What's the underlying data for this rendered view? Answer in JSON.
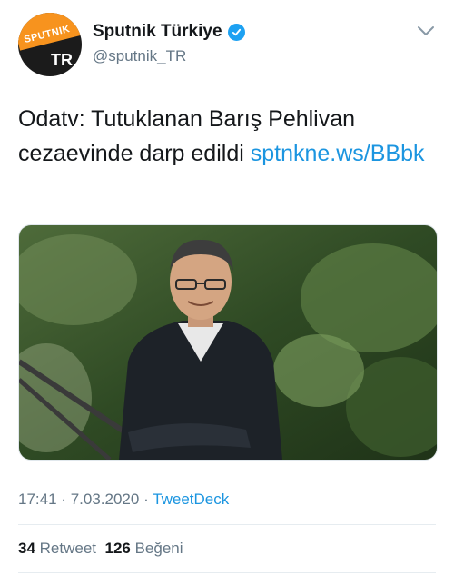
{
  "account": {
    "display_name": "Sputnik Türkiye",
    "handle": "@sputnik_TR",
    "avatar_brand": "SPUTNIK",
    "avatar_region": "TR",
    "verified_icon": "verified-badge-icon",
    "brand_color": "#f7931e"
  },
  "tweet": {
    "text_plain": "Odatv: Tutuklanan Barış Pehlivan cezaevinde darp edildi ",
    "link_text": "sptnkne.ws/BBbk",
    "link_color": "#1b95e0"
  },
  "media": {
    "icon": "photo-of-man-in-suit"
  },
  "meta": {
    "time": "17:41",
    "date": "7.03.2020",
    "separator": "·",
    "source": "TweetDeck"
  },
  "stats": {
    "retweet_count": "34",
    "retweet_label": "Retweet",
    "like_count": "126",
    "like_label": "Beğeni"
  }
}
